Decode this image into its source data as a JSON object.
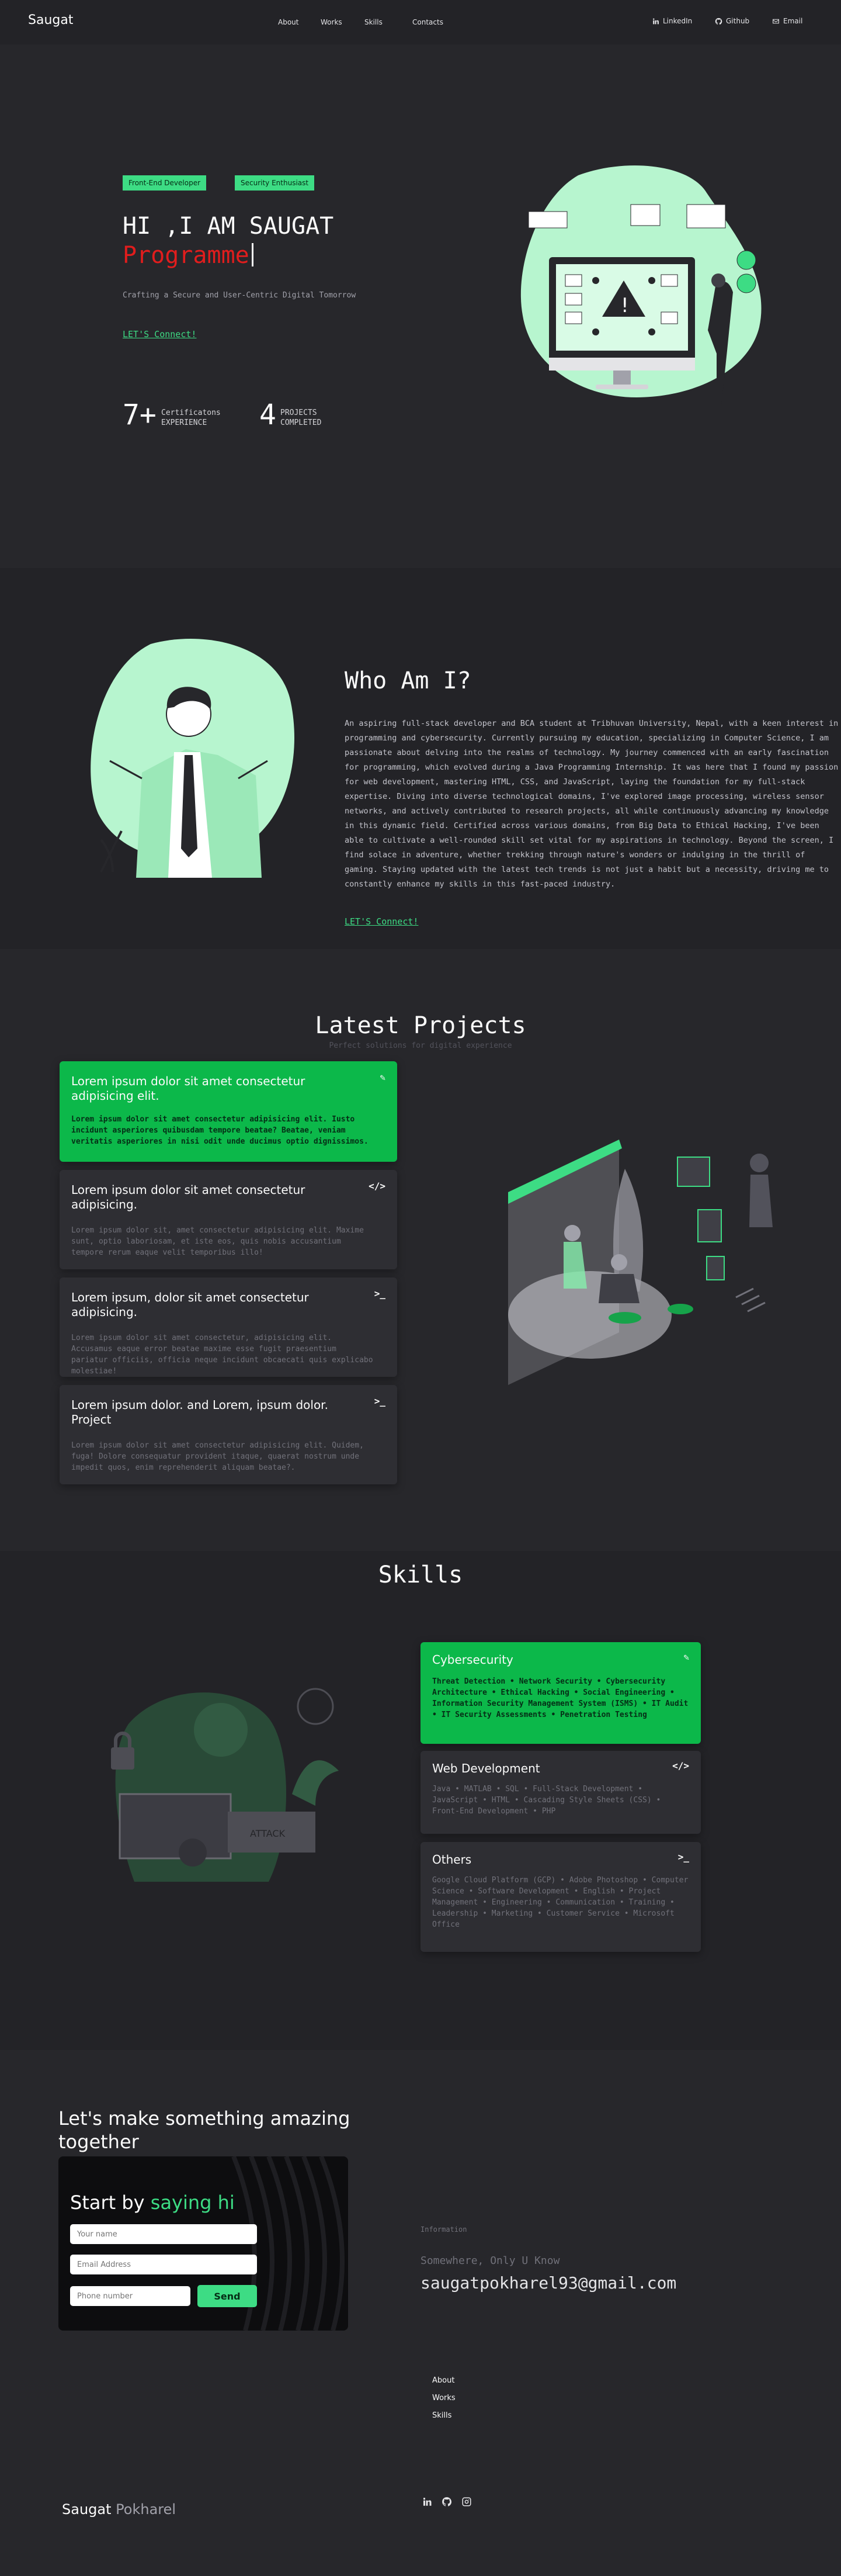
{
  "nav": {
    "brand": "Saugat",
    "links": [
      "About",
      "Works",
      "Skills",
      "Contacts"
    ],
    "socials": [
      "LinkedIn",
      "Github",
      "Email"
    ]
  },
  "hero": {
    "tags": [
      "Front-End Developer",
      "Security Enthusiast"
    ],
    "greeting": "HI ,I AM SAUGAT",
    "role": "Programme",
    "tagline": "Crafting a Secure and User-Centric Digital Tomorrow",
    "cta": "LET'S Connect!",
    "stats": [
      {
        "num": "7+",
        "line1": "Certificatons",
        "line2": "EXPERIENCE"
      },
      {
        "num": "4",
        "line1": "PROJECTS",
        "line2": "COMPLETED"
      }
    ]
  },
  "about": {
    "title": "Who Am I?",
    "text": "An aspiring full-stack developer and BCA student at Tribhuvan University, Nepal, with a keen interest in programming and cybersecurity. Currently pursuing my education, specializing in Computer Science, I am passionate about delving into the realms of technology.  My journey commenced with an early fascination for programming, which evolved during a Java Programming Internship.  It was here that I found my passion for web development, mastering HTML, CSS, and JavaScript, laying the foundation for my full-stack expertise.  Diving into diverse technological domains, I've explored image processing, wireless sensor networks, and actively contributed to research projects, all while continuously advancing my knowledge in this dynamic field. Certified across various domains, from Big Data to Ethical Hacking, I've been able to cultivate a well-rounded skill set vital for my aspirations in technology. Beyond the screen, I find solace in adventure, whether trekking through nature's wonders or indulging in the thrill of gaming.  Staying updated with the latest tech trends is not just a habit but a necessity, driving me to constantly enhance my skills in this fast-paced industry.",
    "cta": "LET'S Connect!"
  },
  "projects": {
    "title": "Latest Projects",
    "subtitle": "Perfect solutions for digital experience",
    "items": [
      {
        "title": "Lorem ipsum dolor sit amet consectetur adipisicing elit.",
        "desc": "Lorem ipsum dolor sit amet consectetur adipisicing elit. Iusto incidunt asperiores quibusdam tempore beatae? Beatae, veniam veritatis asperiores in nisi odit unde ducimus optio dignissimos.",
        "icon": "✎"
      },
      {
        "title": "Lorem ipsum dolor sit amet consectetur adipisicing.",
        "desc": "Lorem ipsum dolor sit, amet consectetur adipisicing elit. Maxime sunt, optio laboriosam, et iste eos, quis nobis accusantium tempore rerum eaque velit temporibus illo!",
        "icon": "</>"
      },
      {
        "title": "Lorem ipsum, dolor sit amet consectetur adipisicing.",
        "desc": "Lorem ipsum dolor sit amet consectetur, adipisicing elit. Accusamus eaque error beatae maxime esse fugit praesentium pariatur officiis, officia neque incidunt obcaecati quis explicabo molestiae!",
        "icon": ">_"
      },
      {
        "title": "Lorem ipsum dolor. and Lorem, ipsum dolor. Project",
        "desc": "Lorem ipsum dolor sit amet consectetur adipisicing elit. Quidem, fuga! Dolore consequatur provident itaque, quaerat nostrum unde impedit quos, enim reprehenderit aliquam beatae?.",
        "icon": ">_"
      }
    ]
  },
  "skills": {
    "title": "Skills",
    "illustration_label": "ATTACK",
    "items": [
      {
        "title": "Cybersecurity",
        "desc": "Threat Detection • Network Security • Cybersecurity Architecture • Ethical Hacking • Social Engineering • Information Security Management System (ISMS) • IT Audit • IT Security Assessments • Penetration Testing",
        "icon": "✎"
      },
      {
        "title": "Web Development",
        "desc": "Java • MATLAB • SQL • Full-Stack Development • JavaScript • HTML • Cascading Style Sheets (CSS) • Front-End Development • PHP",
        "icon": "</>"
      },
      {
        "title": "Others",
        "desc": "Google Cloud Platform (GCP) • Adobe Photoshop • Computer Science • Software Development • English • Project Management • Engineering • Communication • Training • Leadership • Marketing • Customer Service • Microsoft Office",
        "icon": ">_"
      }
    ]
  },
  "contact": {
    "title": "Let's make something amazing together",
    "form_title_start": "Start by",
    "form_title_accent": "saying hi",
    "placeholders": {
      "name": "Your name",
      "email": "Email Address",
      "phone": "Phone number"
    },
    "send": "Send",
    "info_label": "Information",
    "location": "Somewhere, Only U Know",
    "email": "saugatpokharel93@gmail.com"
  },
  "footer": {
    "links": [
      "About",
      "Works",
      "Skills"
    ],
    "brand_first": "Saugat",
    "brand_last": "Pokharel"
  },
  "colors": {
    "accent": "#3ddc84",
    "card_active": "#0cb84a",
    "role": "#e11d1d",
    "bg": "#27272b"
  }
}
